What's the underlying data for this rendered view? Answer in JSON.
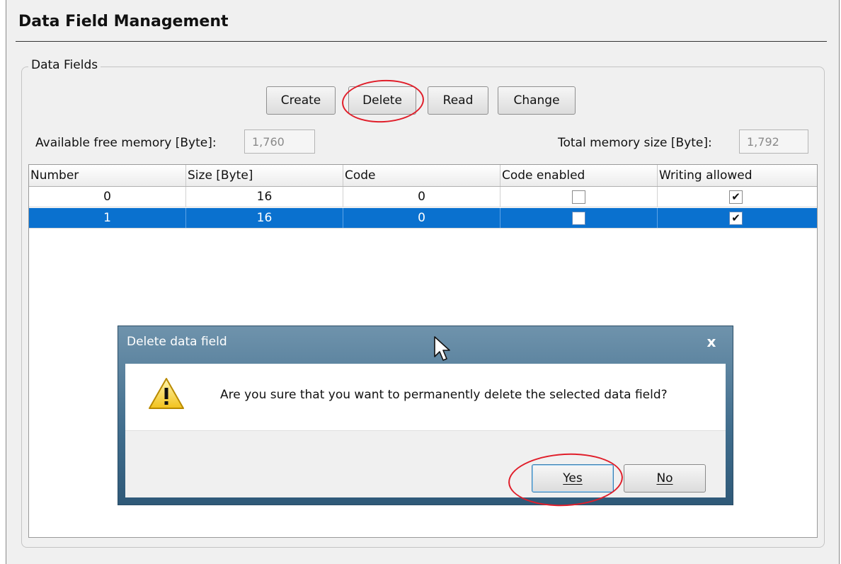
{
  "header": {
    "title": "Data Field Management"
  },
  "group": {
    "legend": "Data Fields"
  },
  "toolbar": {
    "create": "Create",
    "delete": "Delete",
    "read": "Read",
    "change": "Change"
  },
  "memory": {
    "free_label": "Available free memory [Byte]:",
    "free_value": "1,760",
    "total_label": "Total memory size [Byte]:",
    "total_value": "1,792"
  },
  "table": {
    "columns": [
      "Number",
      "Size [Byte]",
      "Code",
      "Code enabled",
      "Writing allowed"
    ],
    "rows": [
      {
        "number": "0",
        "size": "16",
        "code": "0",
        "code_enabled": false,
        "writing_allowed": true,
        "selected": false
      },
      {
        "number": "1",
        "size": "16",
        "code": "0",
        "code_enabled": false,
        "writing_allowed": true,
        "selected": true
      }
    ]
  },
  "dialog": {
    "title": "Delete data field",
    "close": "x",
    "message": "Are you sure that you want to permanently delete the selected data field?",
    "yes": "Yes",
    "no": "No",
    "icon": "warning-icon"
  },
  "colors": {
    "selection": "#0a71cf",
    "callout": "#e01e2a",
    "dialog_frame": "#3f6c8c"
  }
}
